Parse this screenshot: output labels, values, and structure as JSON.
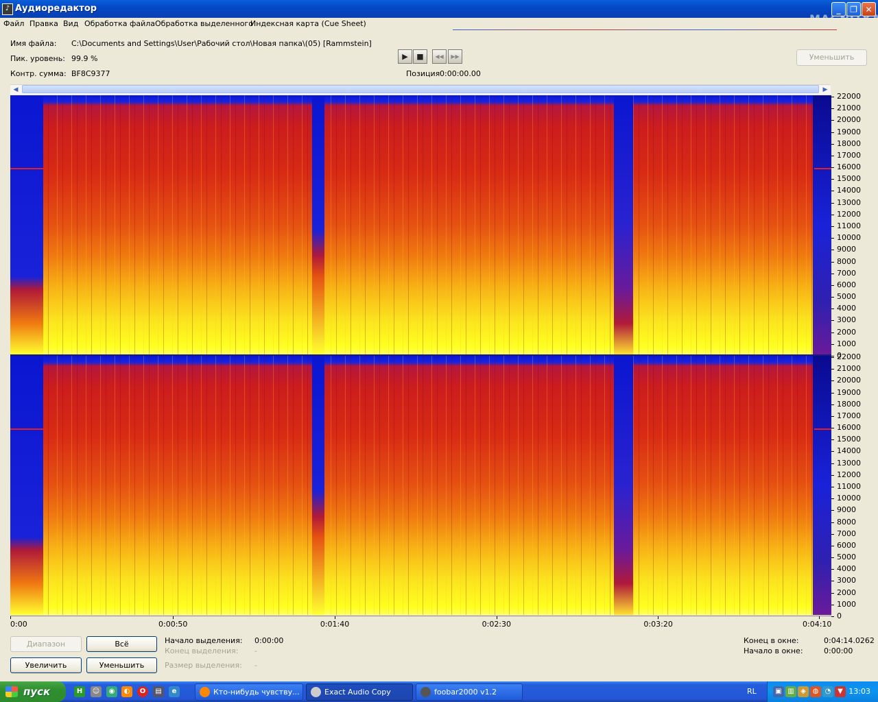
{
  "window": {
    "title": "Аудиоредактор",
    "icon": "app-icon",
    "logo": "MAGNITKA"
  },
  "menu": [
    "Файл",
    "Правка",
    "Вид",
    "Обработка файла",
    "Обработка выделенного",
    "Индексная карта (Cue Sheet)"
  ],
  "info": {
    "file_label": "Имя файла:",
    "file_value": "C:\\Documents and Settings\\User\\Рабочий стол\\Новая папка\\(05) [Rammstein]",
    "peak_label": "Пик. уровень:",
    "peak_value": "99.9 %",
    "crc_label": "Контр. сумма:",
    "crc_value": "BF8C9377"
  },
  "transport": {
    "play": "▶",
    "stop": "■",
    "rewind": "◀◀",
    "forward": "▶▶",
    "position_label": "Позиция",
    "position_value": "0:00:00.00"
  },
  "zoom_out_top": "Уменьшить",
  "freq_ticks": [
    "22000",
    "21000",
    "20000",
    "19000",
    "18000",
    "17000",
    "16000",
    "15000",
    "14000",
    "13000",
    "12000",
    "11000",
    "10000",
    "9000",
    "8000",
    "7000",
    "6000",
    "5000",
    "4000",
    "3000",
    "2000",
    "1000",
    "0"
  ],
  "time_ticks": [
    "0:00",
    "0:00:50",
    "0:01:40",
    "0:02:30",
    "0:03:20",
    "0:04:10"
  ],
  "bottom": {
    "range_button": "Диапазон",
    "all_button": "Всё",
    "zoom_in_button": "Увеличить",
    "zoom_out_button": "Уменьшить",
    "sel_start_label": "Начало выделения:",
    "sel_start_value": "0:00:00",
    "sel_end_label": "Конец выделения:",
    "sel_end_value": "-",
    "sel_size_label": "Размер выделения:",
    "sel_size_value": "-",
    "win_end_label": "Конец в окне:",
    "win_end_value": "0:04:14.0262",
    "win_start_label": "Начало в окне:",
    "win_start_value": "0:00:00"
  },
  "taskbar": {
    "start": "пуск",
    "tasks": [
      "Кто-нибудь чувству...",
      "Exact Audio Copy",
      "foobar2000 v1.2"
    ],
    "lang": "RL",
    "clock": "13:03"
  }
}
